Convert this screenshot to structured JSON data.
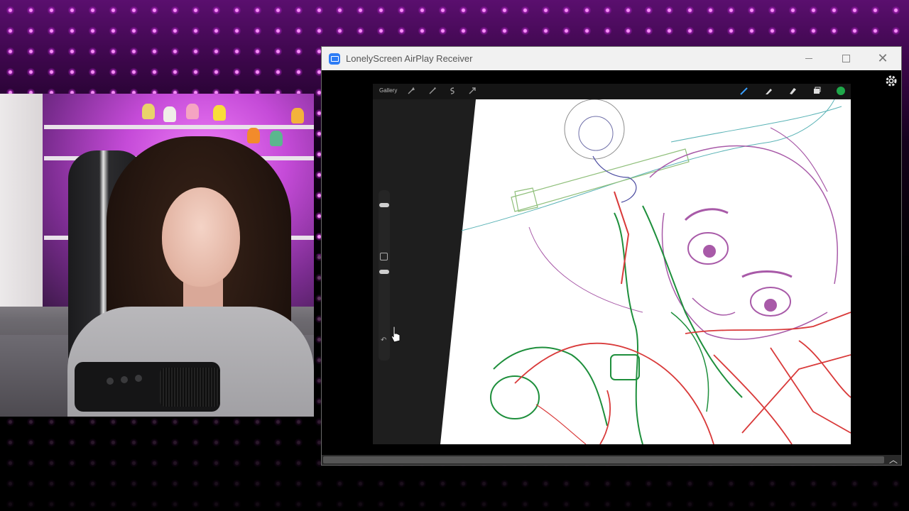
{
  "window": {
    "title": "LonelyScreen AirPlay Receiver",
    "controls": {
      "minimize": "minimize",
      "maximize": "maximize",
      "close": "✕"
    }
  },
  "procreate": {
    "gallery_label": "Gallery",
    "left_tools": [
      "wrench-icon",
      "magic-wand-icon",
      "selection-icon",
      "transform-icon"
    ],
    "right_tools": [
      "brush-icon",
      "smudge-icon",
      "eraser-icon",
      "layers-icon",
      "color-swatch"
    ],
    "accent_color": "#3aa0ff",
    "active_color": "#1fa84a",
    "undo_label": "↶"
  },
  "sketch_colors": {
    "blue": "#5f8fcf",
    "teal": "#5ab3b6",
    "green": "#1e8f3c",
    "red": "#d93a3a",
    "purple": "#a85aa8",
    "gray": "#8c8c8c"
  },
  "scroll": {
    "collapse_label": "︿"
  }
}
